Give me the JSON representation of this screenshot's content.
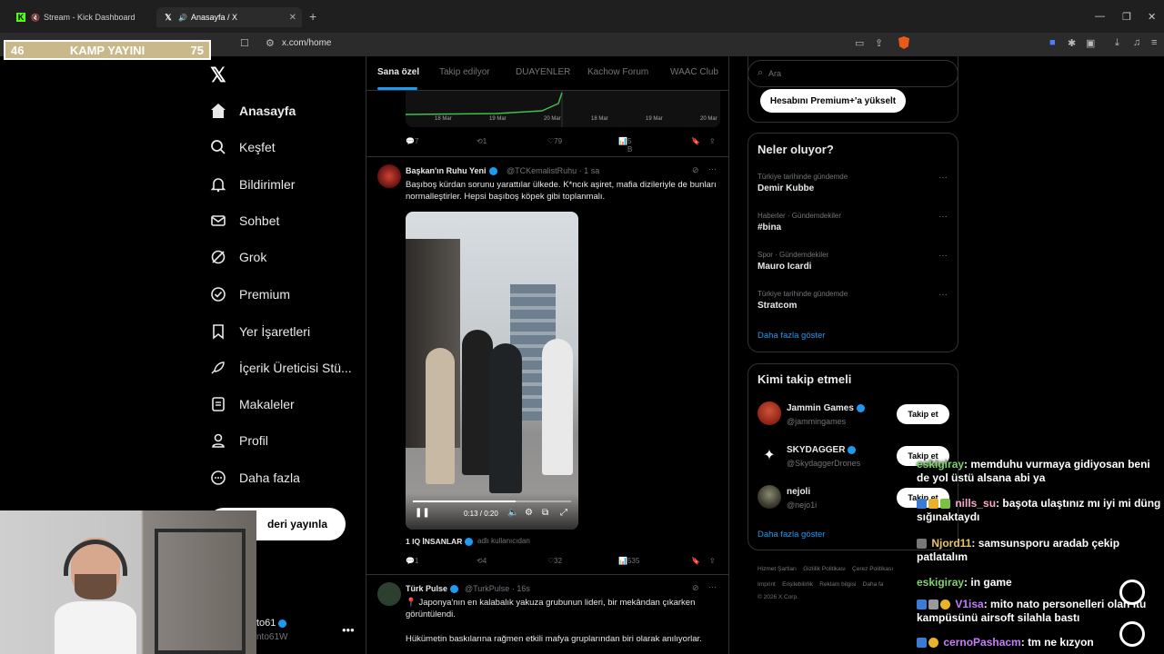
{
  "browser": {
    "tabs": [
      {
        "label": "Stream - Kick Dashboard",
        "active": false
      },
      {
        "label": "Anasayfa / X",
        "active": true
      }
    ],
    "url": "x.com/home"
  },
  "stream_overlay": {
    "left": "46",
    "title": "KAMP YAYINI",
    "right": "75"
  },
  "nav": {
    "items": [
      {
        "label": "Anasayfa",
        "icon": "home-icon"
      },
      {
        "label": "Keşfet",
        "icon": "search-icon"
      },
      {
        "label": "Bildirimler",
        "icon": "bell-icon"
      },
      {
        "label": "Sohbet",
        "icon": "mail-icon"
      },
      {
        "label": "Grok",
        "icon": "grok-icon"
      },
      {
        "label": "Premium",
        "icon": "premium-icon"
      },
      {
        "label": "Yer İşaretleri",
        "icon": "bookmark-icon"
      },
      {
        "label": "İçerik Üreticisi Stü...",
        "icon": "rocket-icon"
      },
      {
        "label": "Makaleler",
        "icon": "article-icon"
      },
      {
        "label": "Profil",
        "icon": "user-icon"
      },
      {
        "label": "Daha fazla",
        "icon": "more-circle-icon"
      }
    ],
    "post_button": "deri yayınla",
    "account_name": "to61",
    "account_handle": "nto61W"
  },
  "feed": {
    "tabs": [
      "Sana özel",
      "Takip edilyor",
      "DUAYENLER",
      "Kachow Forum",
      "WAAC Club"
    ],
    "chart_labels": [
      "18 Mar",
      "19 Mar",
      "20 Mar",
      "18 Mar",
      "19 Mar",
      "20 Mar"
    ],
    "tweet0_actions": {
      "replies": "7",
      "retweets": "1",
      "likes": "79",
      "views": "5 B"
    },
    "tweet1": {
      "name": "Başkan'ın Ruhu Yeni",
      "handle": "@TCKemalistRuhu",
      "time": "· 1 sa",
      "text": "Başıboş kürdan sorunu yarattılar ülkede.  K*ncık aşiret, mafia dizileriyle de bunları normalleştirler. Hepsi başıboş köpek gibi toplanmalı.",
      "video_time": "0:13 / 0:20",
      "video_progress": 0.65,
      "caption_name": "1 IQ İNSANLAR",
      "caption_suffix": "adlı kullanıcıdan",
      "replies": "1",
      "retweets": "4",
      "likes": "32",
      "views": "535"
    },
    "tweet2": {
      "name": "Türk Pulse",
      "handle": "@TurkPulse",
      "time": "· 16s",
      "text": "📍 Japonya'nın en kalabalık yakuza grubunun lideri, bir mekândan çıkarken görüntülendi.",
      "text2": "Hükümetin baskılarına rağmen etkili mafya gruplarından biri olarak anılıyorlar."
    }
  },
  "right": {
    "search_placeholder": "Ara",
    "premium_button": "Hesabını Premium+'a yükselt",
    "trends_title": "Neler oluyor?",
    "trends": [
      {
        "category": "Türkiye tarihinde gündemde",
        "name": "Demir Kubbe"
      },
      {
        "category": "Haberler · Gündemdekiler",
        "name": "#bina"
      },
      {
        "category": "Spor · Gündemdekiler",
        "name": "Mauro Icardi"
      },
      {
        "category": "Türkiye tarihinde gündemde",
        "name": "Stratcom"
      }
    ],
    "show_more": "Daha fazla göster",
    "who_title": "Kimi takip etmeli",
    "who": [
      {
        "name": "Jammin Games",
        "handle": "@jammingames",
        "button": "Takip et"
      },
      {
        "name": "SKYDAGGER",
        "handle": "@SkydaggerDrones",
        "button": "Takip et"
      },
      {
        "name": "nejoli",
        "handle": "@nejo1i",
        "button": "Takip et"
      }
    ],
    "who_more": "Daha fazla göster",
    "footer1": [
      "Hizmet Şartları",
      "Gizlilik Politikası",
      "Çerez Politikası"
    ],
    "footer2": [
      "Imprint",
      "Erişilebilirlik",
      "Reklam bilgisi",
      "Daha fa"
    ],
    "copyright": "© 2026 X Corp."
  },
  "chat": [
    {
      "user": "eskigiray",
      "color": "#7fd36b",
      "text": ": memduhu vurmaya gidiyosan beni de yol üstü alsana abi ya"
    },
    {
      "user": "nills_su",
      "color": "#f7a7c8",
      "text": ": başota ulaştınız mı iyi mi düng sığınaktaydı"
    },
    {
      "user": "Njord11",
      "color": "#e8c46b",
      "text": ": samsunsporu aradab çekip patlatalım"
    },
    {
      "user": "eskigiray",
      "color": "#7fd36b",
      "text": ": in game"
    },
    {
      "user": "V1isa",
      "color": "#c77dff",
      "text": ": mito nato personelleri olan itu kampüsünü airsoft silahla bastı"
    },
    {
      "user": "cernoPashacm",
      "color": "#c77dff",
      "text": ": tm ne kızyon"
    }
  ]
}
